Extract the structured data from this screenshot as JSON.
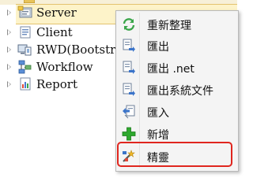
{
  "tree": {
    "nodes": [
      {
        "label": "Server",
        "icon": "server-tree-icon",
        "selected": true
      },
      {
        "label": "Client",
        "icon": "client-page-icon"
      },
      {
        "label": "RWD(Bootstrap)",
        "icon": "rwd-devices-icon"
      },
      {
        "label": "Workflow",
        "icon": "workflow-icon"
      },
      {
        "label": "Report",
        "icon": "report-icon"
      }
    ]
  },
  "context_menu": {
    "items": [
      {
        "label": "重新整理",
        "icon": "refresh-icon"
      },
      {
        "label": "匯出",
        "icon": "export-icon"
      },
      {
        "label": "匯出 .net",
        "icon": "export-dotnet-icon"
      },
      {
        "label": "匯出系統文件",
        "icon": "export-docs-icon"
      },
      {
        "label": "匯入",
        "icon": "import-icon"
      },
      {
        "label": "新增",
        "icon": "add-plus-icon"
      },
      {
        "label": "精靈",
        "icon": "wizard-icon",
        "highlighted": true
      }
    ]
  },
  "colors": {
    "selection_bg": "#fdf3c9",
    "menu_bg": "#f4f4f4",
    "highlight_border": "#e0261e",
    "add_green": "#2fa92f",
    "refresh_green": "#3aa54a"
  }
}
